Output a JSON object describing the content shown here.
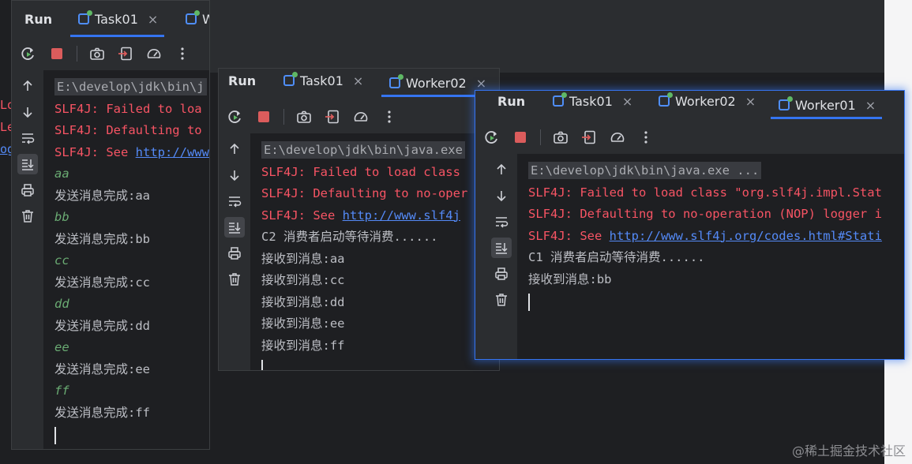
{
  "background": {
    "fragments": [
      "Lo",
      "Le",
      "og"
    ]
  },
  "toolbar_icons": [
    "rerun-icon",
    "stop-icon",
    "camera-icon",
    "exit-icon",
    "speed-icon",
    "more-icon"
  ],
  "side_icons": [
    "arrow-up-icon",
    "arrow-down-icon",
    "soft-wrap-icon",
    "scroll-to-end-icon",
    "print-icon",
    "trash-icon"
  ],
  "panel1": {
    "run": "Run",
    "tabs": [
      {
        "label": "Task01",
        "close": "×"
      },
      {
        "label": "W"
      }
    ],
    "lines": [
      "E:\\develop\\jdk\\bin\\j",
      "SLF4J: Failed to loa",
      "SLF4J: Defaulting to",
      "SLF4J: See ",
      "http://www",
      "aa",
      "发送消息完成:aa",
      "bb",
      "发送消息完成:bb",
      "cc",
      "发送消息完成:cc",
      "dd",
      "发送消息完成:dd",
      "ee",
      "发送消息完成:ee",
      "ff",
      "发送消息完成:ff"
    ]
  },
  "panel2": {
    "run": "Run",
    "tabs": [
      {
        "label": "Task01",
        "close": "×"
      },
      {
        "label": "Worker02",
        "close": "×"
      }
    ],
    "lines": [
      "E:\\develop\\jdk\\bin\\java.exe",
      "SLF4J: Failed to load class",
      "SLF4J: Defaulting to no-oper",
      "SLF4J: See ",
      "http://www.slf4j",
      "C2 消费者启动等待消费......",
      "接收到消息:aa",
      "接收到消息:cc",
      "接收到消息:dd",
      "接收到消息:ee",
      "接收到消息:ff"
    ]
  },
  "panel3": {
    "run": "Run",
    "tabs": [
      {
        "label": "Task01",
        "close": "×"
      },
      {
        "label": "Worker02",
        "close": "×"
      },
      {
        "label": "Worker01",
        "close": "×"
      }
    ],
    "lines": [
      "E:\\develop\\jdk\\bin\\java.exe ...",
      "SLF4J: Failed to load class \"org.slf4j.impl.Stat",
      "SLF4J: Defaulting to no-operation (NOP) logger i",
      "SLF4J: See ",
      "http://www.slf4j.org/codes.html#Stati",
      "C1 消费者启动等待消费......",
      "接收到消息:bb"
    ]
  },
  "watermark": "@稀土掘金技术社区"
}
